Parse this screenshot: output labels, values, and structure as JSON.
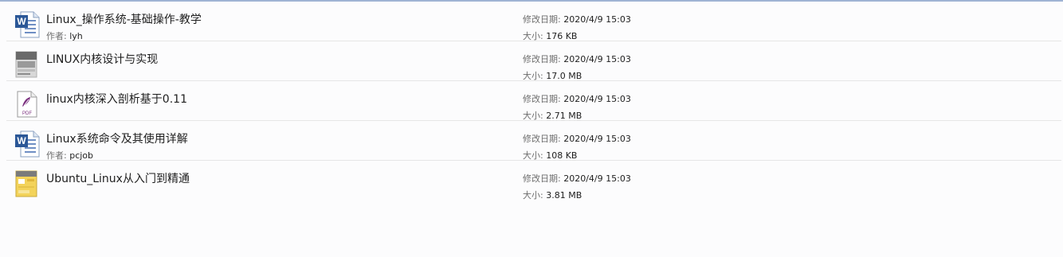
{
  "files": [
    {
      "name": "Linux_操作系统-基础操作-教学",
      "icon": "word-document-icon",
      "author_label": "作者:",
      "author": "lyh",
      "date_label": "修改日期:",
      "date": "2020/4/9 15:03",
      "size_label": "大小:",
      "size": "176 KB"
    },
    {
      "name": "LINUX内核设计与实现",
      "icon": "book-thumbnail-icon",
      "date_label": "修改日期:",
      "date": "2020/4/9 15:03",
      "size_label": "大小:",
      "size": "17.0 MB"
    },
    {
      "name": "linux内核深入剖析基于0.11",
      "icon": "pdf-document-icon",
      "date_label": "修改日期:",
      "date": "2020/4/9 15:03",
      "size_label": "大小:",
      "size": "2.71 MB"
    },
    {
      "name": "Linux系统命令及其使用详解",
      "icon": "word-document-icon",
      "author_label": "作者:",
      "author": "pcjob",
      "date_label": "修改日期:",
      "date": "2020/4/9 15:03",
      "size_label": "大小:",
      "size": "108 KB"
    },
    {
      "name": "Ubuntu_Linux从入门到精通",
      "icon": "book-thumbnail-icon",
      "date_label": "修改日期:",
      "date": "2020/4/9 15:03",
      "size_label": "大小:",
      "size": "3.81 MB"
    }
  ],
  "colors": {
    "word_blue": "#2b5797",
    "pdf_purple": "#7a2f7e",
    "border": "#e6e6e6"
  }
}
